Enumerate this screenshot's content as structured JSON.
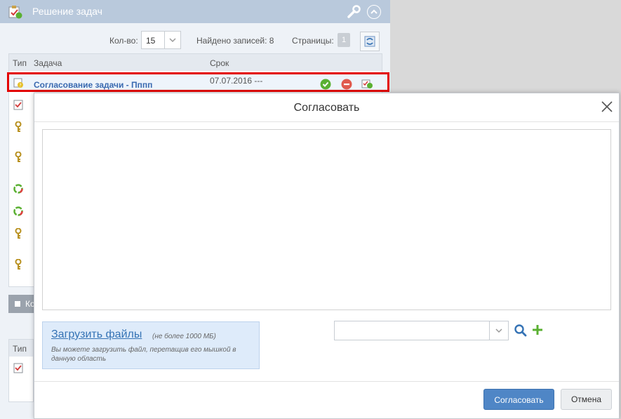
{
  "widget": {
    "title": "Решение задач",
    "count_label": "Кол-во:",
    "count_value": "15",
    "found_label": "Найдено записей: 8",
    "pages_label": "Страницы:",
    "page_number": "1",
    "columns": {
      "type": "Тип",
      "task": "Задача",
      "deadline": "Срок"
    },
    "selected_row": {
      "task": "Согласование задачи - Пппп",
      "date": "07.07.2016  ---"
    },
    "row_icons": [
      "doc-check-icon",
      "key-icon",
      "key-icon",
      "cycle-icon",
      "cycle-icon",
      "key-icon",
      "key-icon"
    ],
    "section_label": "Ко",
    "table2_column_type": "Тип"
  },
  "modal": {
    "title": "Согласовать",
    "comment_value": "",
    "upload_link": "Загрузить файлы",
    "upload_limit": "(не более 1000 МБ)",
    "upload_hint": "Вы можете загрузить файл, перетащив его мышкой в данную область",
    "combo_value": "",
    "approve_button": "Согласовать",
    "cancel_button": "Отмена"
  },
  "colors": {
    "header": "#b9c9dc",
    "highlight": "#e30000",
    "link": "#3a6ab0",
    "primary_button": "#4f86c6",
    "add_icon": "#5ab031",
    "search_icon": "#3573b5"
  }
}
